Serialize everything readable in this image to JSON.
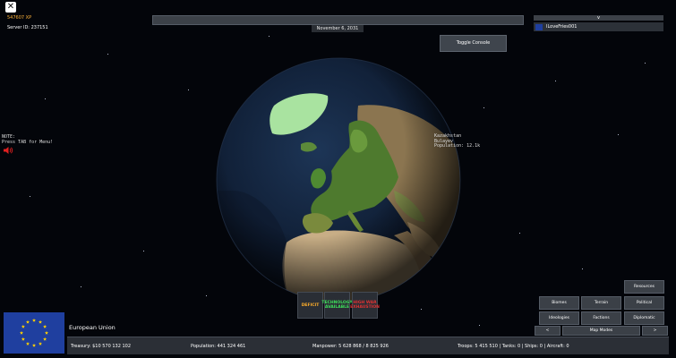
{
  "hud": {
    "xp": "547607 XP",
    "server_id": "Server ID: 237151",
    "date": "November 6, 2031",
    "toggle_console": "Toggle Console",
    "note_line1": "NOTE:",
    "note_line2": "Press TAB for Menu!"
  },
  "playerlist": {
    "collapse_label": "v",
    "players": [
      {
        "name": "ILoveFries001"
      }
    ]
  },
  "map_label": {
    "region": "Kazakhstan",
    "city": "Bulayev",
    "population": "Population: 12.1k"
  },
  "status": {
    "deficit": "DEFICIT",
    "tech": "TECHNOLOGY AVAILABLE",
    "war": "HIGH WAR EXHAUSTION"
  },
  "map_modes": {
    "resources": "Resources",
    "biomes": "Biomes",
    "terrain": "Terrain",
    "political": "Political",
    "ideologies": "Ideologies",
    "factions": "Factions",
    "diplomatic": "Diplomatic",
    "prev": "<",
    "label": "Map Modes",
    "next": ">"
  },
  "country": {
    "name": "European Union",
    "treasury": "Treasury:  $10 570 132 102",
    "population": "Population: 441 324 461",
    "manpower": "Manpower:  5 628 868  /  8 825 926",
    "military": "Troops: 5 415 510  |  Tanks: 0  |  Ships: 0  |  Aircraft: 0"
  },
  "colors": {
    "flag_blue": "#1f3f9f",
    "flag_star": "#ffd200",
    "xp": "#ffb43a",
    "deficit": "#ffae2a",
    "tech": "#3ee05a",
    "war": "#e03232"
  }
}
